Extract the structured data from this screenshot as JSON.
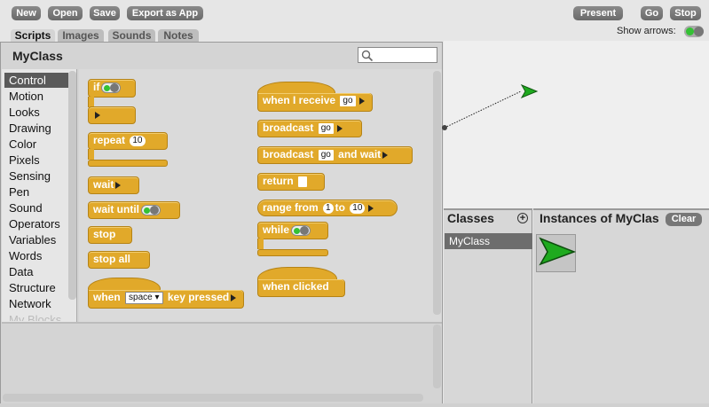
{
  "toolbar": {
    "new": "New",
    "open": "Open",
    "save": "Save",
    "export": "Export as App",
    "present": "Present",
    "go": "Go",
    "stop": "Stop",
    "show_arrows": "Show arrows:"
  },
  "tabs": [
    "Scripts",
    "Images",
    "Sounds",
    "Notes"
  ],
  "class_title": "MyClass",
  "categories": [
    "Control",
    "Motion",
    "Looks",
    "Drawing",
    "Color",
    "Pixels",
    "Sensing",
    "Pen",
    "Sound",
    "Operators",
    "Variables",
    "Words",
    "Data",
    "Structure",
    "Network",
    "My Blocks"
  ],
  "selected_category": "Control",
  "blocks": {
    "if": "if",
    "repeat": "repeat",
    "repeat_count": "10",
    "wait": "wait",
    "wait_until": "wait until",
    "stop": "stop",
    "stop_all": "stop all",
    "when_key": "when",
    "key_value": "space",
    "key_pressed": "key pressed",
    "when_receive": "when I receive",
    "receive_value": "go",
    "broadcast": "broadcast",
    "broadcast_value": "go",
    "broadcast_wait": "broadcast",
    "broadcast_wait_value": "go",
    "and_wait": "and wait",
    "return": "return",
    "range_from": "range from",
    "range_start": "1",
    "range_to": "to",
    "range_end": "10",
    "while": "while",
    "when_clicked": "when clicked"
  },
  "classes_title": "Classes",
  "classes": [
    "MyClass"
  ],
  "instances_title": "Instances of MyClas",
  "clear": "Clear",
  "colors": {
    "block": "#e1a92a",
    "selection": "#5a5a5a",
    "toggle_on": "#34c134",
    "turtle": "#1eaa1e"
  }
}
